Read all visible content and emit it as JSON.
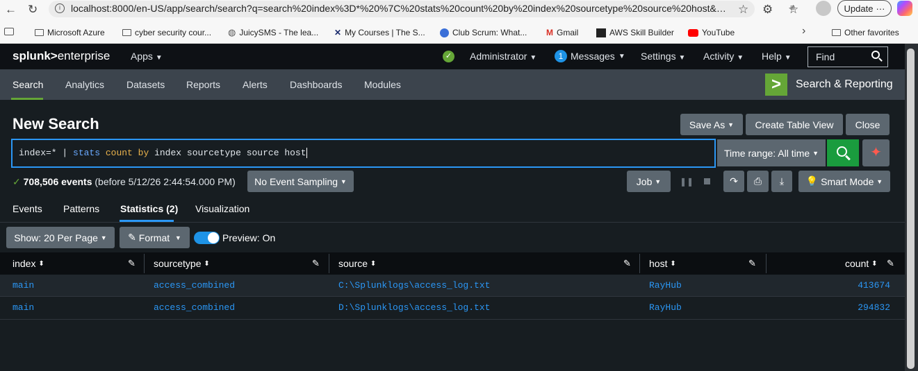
{
  "browser": {
    "url": "localhost:8000/en-US/app/search/search?q=search%20index%3D*%20%7C%20stats%20count%20by%20index%20sourcetype%20source%20host&displ...",
    "update_label": "Update",
    "bookmarks": [
      "Microsoft Azure",
      "cyber security cour...",
      "JuicySMS - The lea...",
      "My Courses | The S...",
      "Club Scrum: What...",
      "Gmail",
      "AWS Skill Builder",
      "YouTube"
    ],
    "other_favorites": "Other favorites"
  },
  "splunk": {
    "logo_a": "splunk>",
    "logo_b": "enterprise",
    "apps": "Apps",
    "administrator": "Administrator",
    "messages_count": "1",
    "messages": "Messages",
    "settings": "Settings",
    "activity": "Activity",
    "help": "Help",
    "find_placeholder": "Find"
  },
  "appnav": {
    "tabs": [
      "Search",
      "Analytics",
      "Datasets",
      "Reports",
      "Alerts",
      "Dashboards",
      "Modules"
    ],
    "app_title": "Search & Reporting"
  },
  "search": {
    "title": "New Search",
    "save_as": "Save As",
    "create_table": "Create Table View",
    "close": "Close",
    "query_parts": [
      "index=* | ",
      "stats",
      " ",
      "count",
      " ",
      "by",
      " index sourcetype source host"
    ],
    "time_range": "Time range: All time",
    "events_count": "708,506 events",
    "events_before": "(before 5/12/26 2:44:54.000 PM)",
    "sampling": "No Event Sampling",
    "job": "Job",
    "smart_mode": "Smart Mode"
  },
  "result_tabs": [
    "Events",
    "Patterns",
    "Statistics (2)",
    "Visualization"
  ],
  "toolbar": {
    "show": "Show: 20 Per Page",
    "format": "Format",
    "preview": "Preview: On"
  },
  "table": {
    "headers": [
      "index",
      "sourcetype",
      "source",
      "host",
      "count"
    ],
    "rows": [
      [
        "main",
        "access_combined",
        "C:\\Splunklogs\\access_log.txt",
        "RayHub",
        "413674"
      ],
      [
        "main",
        "access_combined",
        "D:\\Splunklogs\\access_log.txt",
        "RayHub",
        "294832"
      ]
    ]
  },
  "colors": {
    "accent_green": "#65a637",
    "search_green": "#1a9c3e",
    "link_blue": "#2b97f5",
    "toggle_blue": "#1e93e6"
  }
}
